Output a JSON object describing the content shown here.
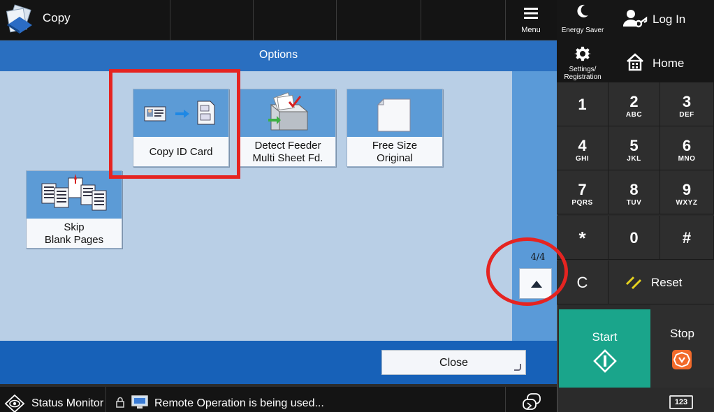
{
  "topbar": {
    "app_title": "Copy",
    "menu_label": "Menu"
  },
  "options": {
    "title": "Options",
    "tiles": [
      {
        "label": "Copy ID Card",
        "icon": "copy-id-card-icon"
      },
      {
        "label": "Detect Feeder\nMulti Sheet Fd.",
        "icon": "detect-feeder-icon"
      },
      {
        "label": "Free Size\nOriginal",
        "icon": "free-size-original-icon"
      },
      {
        "label": "Skip\nBlank Pages",
        "icon": "skip-blank-pages-icon"
      }
    ],
    "page_indicator": "4/4",
    "close_label": "Close"
  },
  "statusbar": {
    "status_monitor_label": "Status Monitor",
    "remote_message": "Remote Operation is being used..."
  },
  "rightpanel": {
    "energy_saver_label": "Energy Saver",
    "login_label": "Log In",
    "settings_label": "Settings/\nRegistration",
    "home_label": "Home",
    "keys": [
      {
        "num": "1",
        "sub": ""
      },
      {
        "num": "2",
        "sub": "ABC"
      },
      {
        "num": "3",
        "sub": "DEF"
      },
      {
        "num": "4",
        "sub": "GHI"
      },
      {
        "num": "5",
        "sub": "JKL"
      },
      {
        "num": "6",
        "sub": "MNO"
      },
      {
        "num": "7",
        "sub": "PQRS"
      },
      {
        "num": "8",
        "sub": "TUV"
      },
      {
        "num": "9",
        "sub": "WXYZ"
      },
      {
        "num": "*",
        "sub": ""
      },
      {
        "num": "0",
        "sub": ""
      },
      {
        "num": "#",
        "sub": ""
      }
    ],
    "clear_label": "C",
    "reset_label": "Reset",
    "start_label": "Start",
    "stop_label": "Stop",
    "keypad_toggle_label": "123"
  },
  "colors": {
    "accent_blue": "#2a6fc0",
    "panel_bg": "#b9cfe6",
    "start_green": "#1aa58b",
    "stop_orange": "#f26a2a",
    "annotation_red": "#e52421"
  }
}
